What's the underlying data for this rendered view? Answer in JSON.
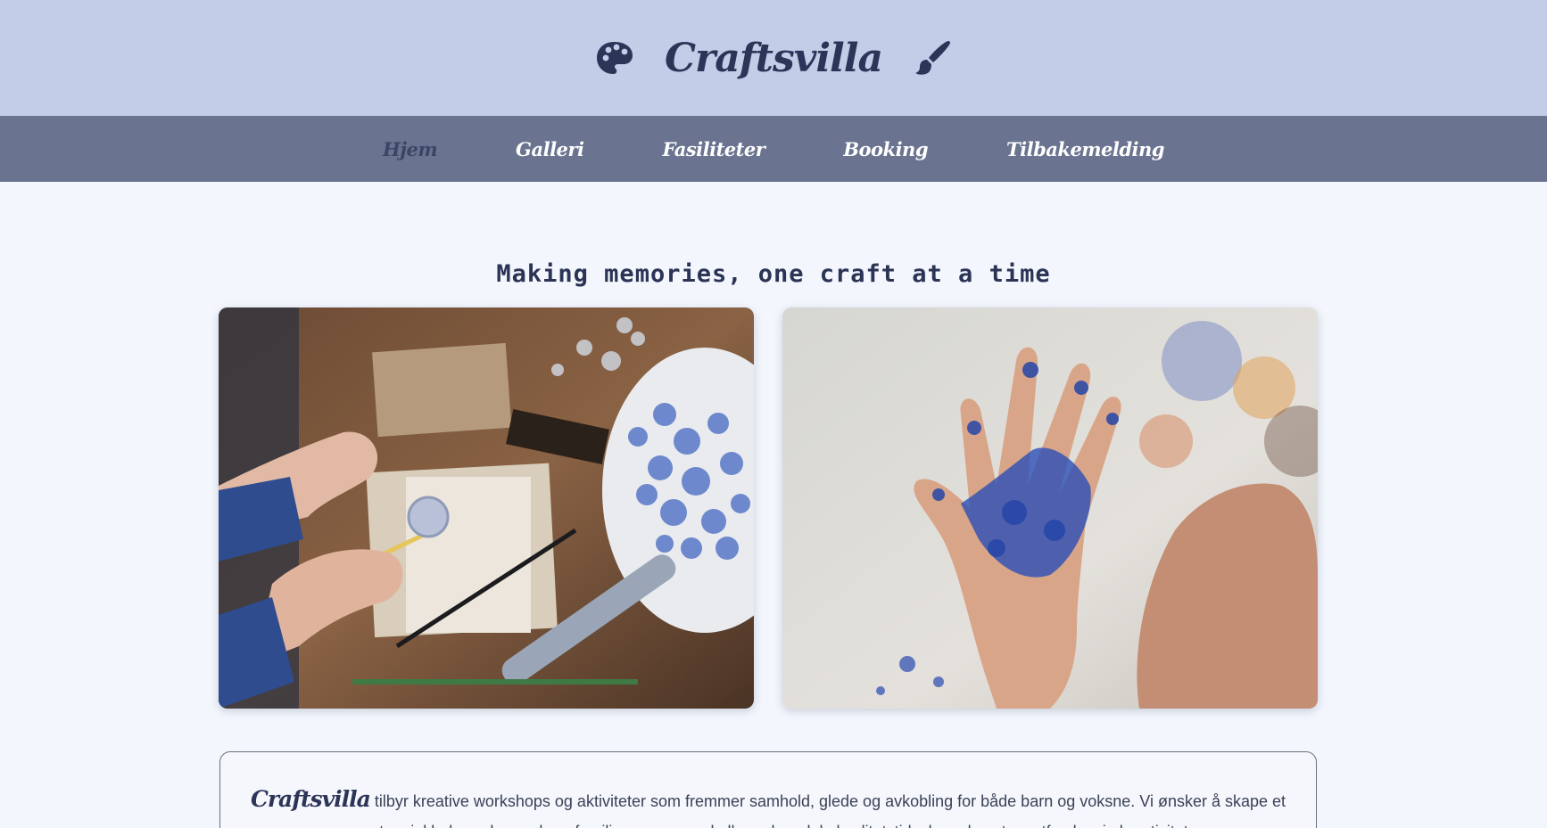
{
  "header": {
    "title": "Craftsvilla",
    "left_icon": "palette-icon",
    "right_icon": "paintbrush-icon",
    "background": "#c3cde7"
  },
  "nav": {
    "background": "#6a738f",
    "items": [
      {
        "label": "Hjem",
        "active": true
      },
      {
        "label": "Galleri",
        "active": false
      },
      {
        "label": "Fasiliteter",
        "active": false
      },
      {
        "label": "Booking",
        "active": false
      },
      {
        "label": "Tilbakemelding",
        "active": false
      }
    ]
  },
  "main": {
    "tagline": "Making memories, one craft at a time",
    "images": [
      {
        "name": "wax-seal-crafting-photo"
      },
      {
        "name": "blue-painted-hand-photo"
      }
    ],
    "info": {
      "brand": "Craftsvilla",
      "text": " tilbyr kreative workshops og aktiviteter som fremmer samhold, glede og avkobling for både barn og voksne. Vi ønsker å skape et varmt og inkluderende rom hvor familier, venner og kolleger kan dele kvalitetstid, skape kunst og utforske sin kreativitet."
    }
  }
}
